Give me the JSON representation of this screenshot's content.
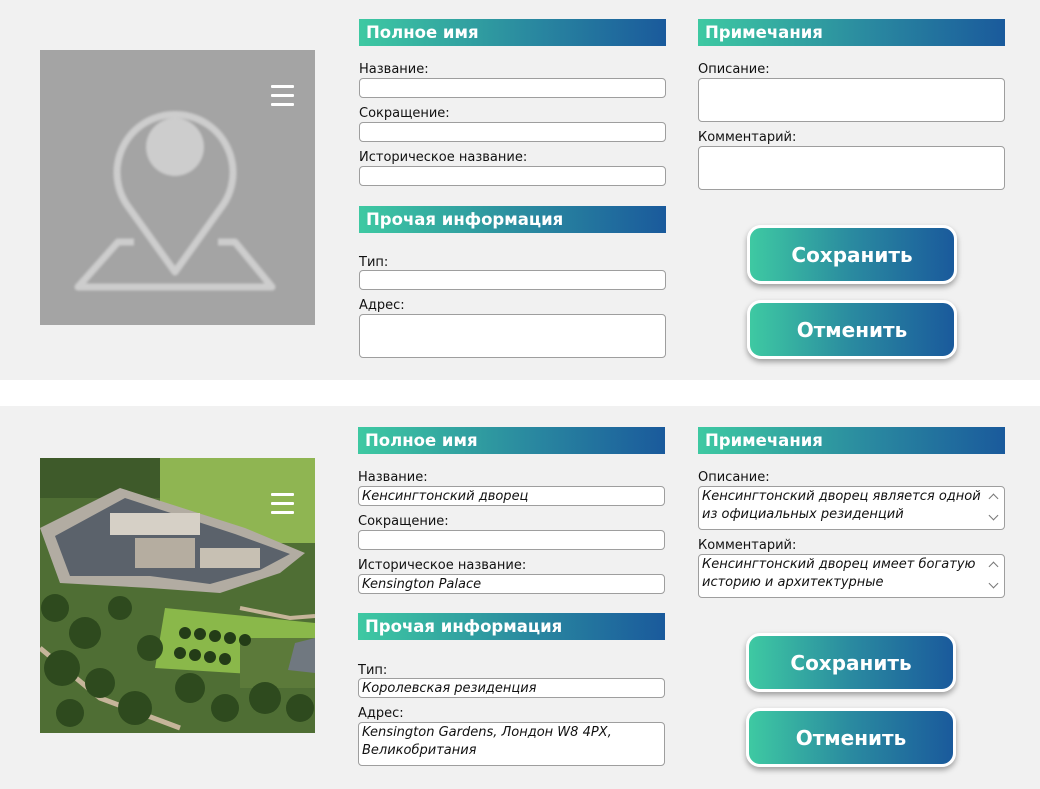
{
  "sections": {
    "full_name": "Полное имя",
    "other_info": "Прочая информация",
    "notes": "Примечания"
  },
  "labels": {
    "name": "Название:",
    "abbreviation": "Сокращение:",
    "historic_name": "Историческое название:",
    "type": "Тип:",
    "address": "Адрес:",
    "description": "Описание:",
    "comment": "Комментарий:"
  },
  "buttons": {
    "save": "Сохранить",
    "cancel": "Отменить"
  },
  "empty_form": {
    "name": "",
    "abbreviation": "",
    "historic_name": "",
    "type": "",
    "address": "",
    "description": "",
    "comment": ""
  },
  "filled_form": {
    "name": "Кенсингтонский дворец",
    "abbreviation": "",
    "historic_name": "Kensington Palace",
    "type": "Королевская резиденция",
    "address": "Kensington Gardens, Лондон W8 4PX, Великобритания",
    "description": "Кенсингтонский дворец является одной из официальных резиденций",
    "comment": "Кенсингтонский дворец имеет богатую историю и архитектурные"
  },
  "icons": {
    "placeholder": "map-pin-icon",
    "menu": "hamburger-menu-icon"
  },
  "colors": {
    "gradient_start": "#3ec9a2",
    "gradient_end": "#1a5a9c",
    "panel_bg": "#f1f1f1"
  }
}
